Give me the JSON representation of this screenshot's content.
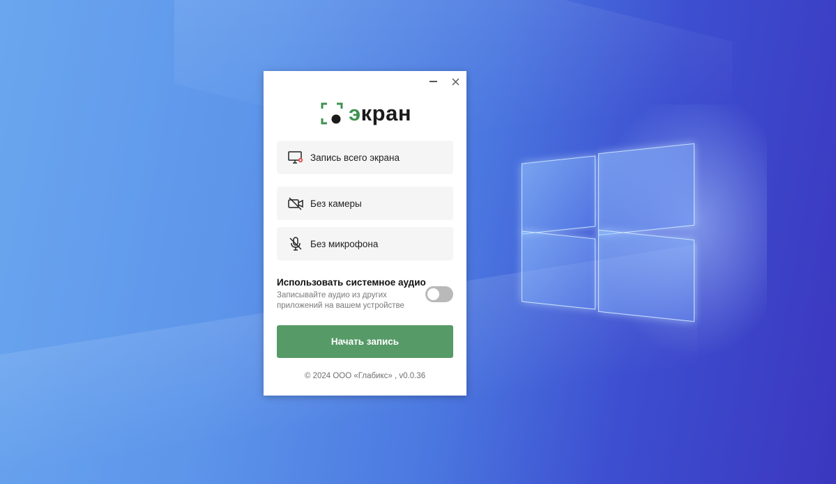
{
  "desktop": {
    "wallpaper": "windows-10-hero",
    "colors": {
      "light": "#6aa6ef",
      "dark": "#3b37bf"
    }
  },
  "app": {
    "controls": {
      "minimize_icon": "minimize-icon",
      "close_icon": "close-icon"
    },
    "logo": {
      "text_prefix": "э",
      "text_rest": "кран",
      "brand_color": "#3f9150",
      "icon": "screen-capture-frame-icon"
    },
    "options": [
      {
        "icon": "monitor-record-icon",
        "label": "Запись всего экрана"
      },
      {
        "icon": "camera-off-icon",
        "label": "Без камеры"
      },
      {
        "icon": "microphone-off-icon",
        "label": "Без микрофона"
      }
    ],
    "system_audio": {
      "title": "Использовать системное аудио",
      "description": "Записывайте аудио из других приложений на вашем устройстве",
      "enabled": false
    },
    "start_button": {
      "label": "Начать запись",
      "color": "#569a67"
    },
    "footer": "© 2024 ООО «Глабикс» , v0.0.36"
  }
}
